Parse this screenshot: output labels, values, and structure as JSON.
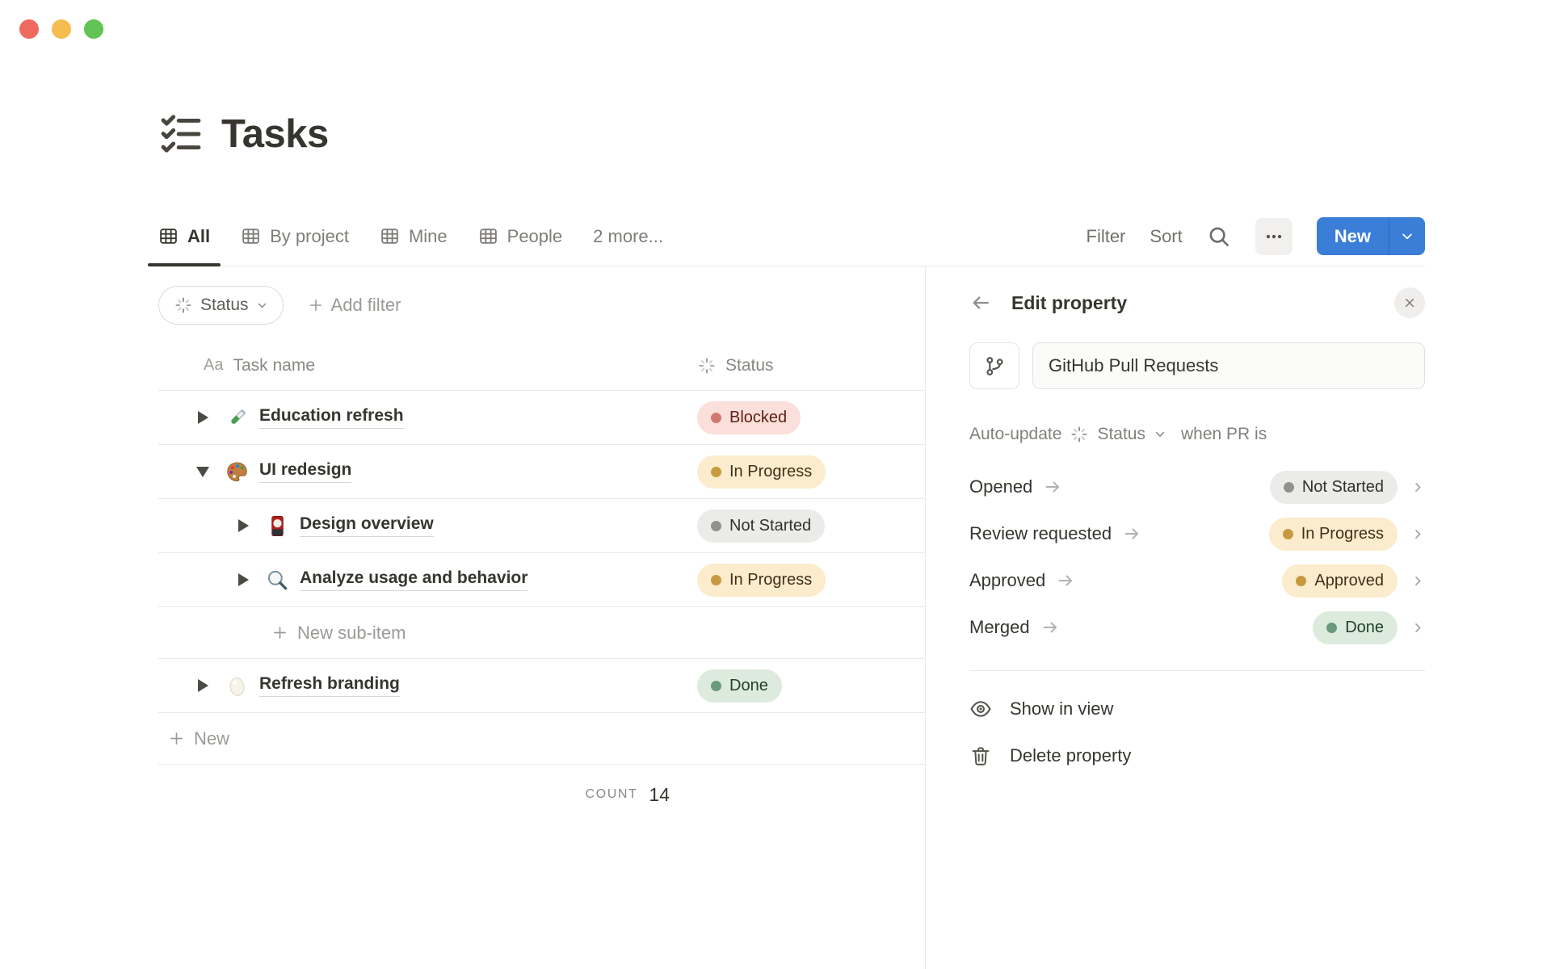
{
  "header": {
    "title": "Tasks"
  },
  "tabs": [
    {
      "label": "All"
    },
    {
      "label": "By project"
    },
    {
      "label": "Mine"
    },
    {
      "label": "People"
    },
    {
      "label": "2 more..."
    }
  ],
  "toolbar": {
    "filter": "Filter",
    "sort": "Sort",
    "new_label": "New"
  },
  "filter_bar": {
    "status_chip": "Status",
    "add_filter": "Add filter"
  },
  "table": {
    "name_col_icon": "Aa",
    "name_col": "Task name",
    "status_col": "Status",
    "rows": [
      {
        "name": "Education refresh",
        "status": "Blocked"
      },
      {
        "name": "UI redesign",
        "status": "In Progress"
      },
      {
        "name": "Design overview",
        "status": "Not Started"
      },
      {
        "name": "Analyze usage and behavior",
        "status": "In Progress"
      },
      {
        "name": "Refresh branding",
        "status": "Done"
      }
    ],
    "new_sub_item": "New sub-item",
    "new_item": "New",
    "count_label": "COUNT",
    "count_value": "14"
  },
  "panel": {
    "title": "Edit property",
    "name_value": "GitHub Pull Requests",
    "auto_update": {
      "prefix": "Auto-update",
      "property": "Status",
      "suffix": "when PR is"
    },
    "mappings": [
      {
        "event": "Opened",
        "status": "Not Started"
      },
      {
        "event": "Review requested",
        "status": "In Progress"
      },
      {
        "event": "Approved",
        "status": "Approved"
      },
      {
        "event": "Merged",
        "status": "Done"
      }
    ],
    "actions": {
      "show": "Show in view",
      "delete": "Delete property"
    }
  },
  "colors": {
    "accent_blue": "#3a7ed8",
    "status_gray_bg": "#ebebe9",
    "status_yellow_bg": "#fbeccd",
    "status_red_bg": "#fbdfda",
    "status_green_bg": "#dcebdd",
    "traffic": [
      "#ee6a5f",
      "#f5bd4f",
      "#61c454"
    ]
  }
}
